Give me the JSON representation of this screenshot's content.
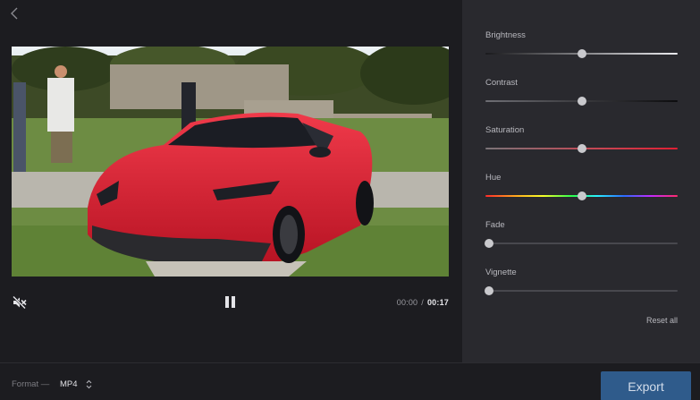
{
  "player": {
    "current_time": "00:00",
    "separator": "/",
    "total_time": "00:17"
  },
  "adjustments": [
    {
      "label": "Brightness",
      "value": 0.5
    },
    {
      "label": "Contrast",
      "value": 0.5
    },
    {
      "label": "Saturation",
      "value": 0.5
    },
    {
      "label": "Hue",
      "value": 0.5
    },
    {
      "label": "Fade",
      "value": 0.0
    },
    {
      "label": "Vignette",
      "value": 0.0
    }
  ],
  "panel": {
    "reset_label": "Reset all"
  },
  "bottom": {
    "format_label": "Format —",
    "format_value": "MP4",
    "export_label": "Export"
  },
  "colors": {
    "accent": "#2f5b8b",
    "panel_bg": "#29292e",
    "app_bg": "#1c1c20"
  }
}
